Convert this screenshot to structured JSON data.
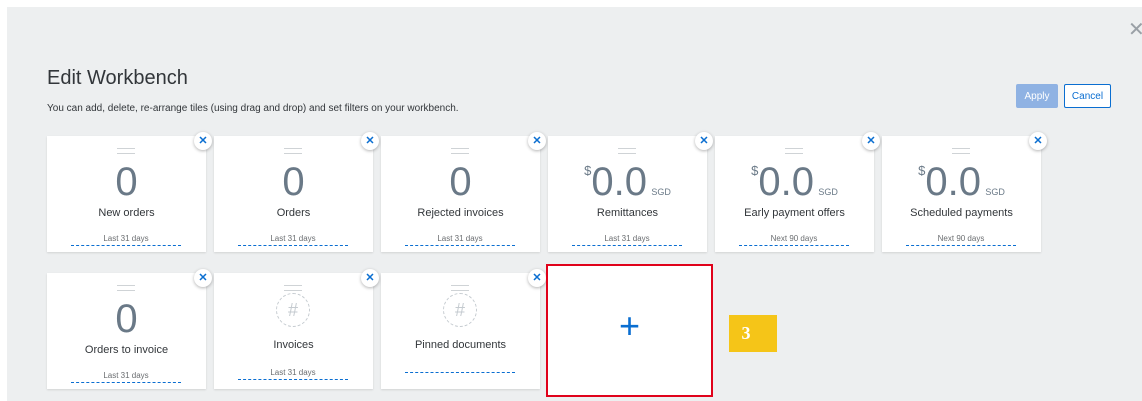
{
  "dialog": {
    "close_glyph": "✕",
    "title": "Edit Workbench",
    "subtitle": "You can add, delete, re-arrange tiles (using drag and drop) and set filters on your workbench.",
    "apply_label": "Apply",
    "cancel_label": "Cancel"
  },
  "tile_remove_glyph": "✕",
  "tiles": [
    {
      "value": "0",
      "label": "New orders",
      "period": "Last 31 days"
    },
    {
      "value": "0",
      "label": "Orders",
      "period": "Last 31 days"
    },
    {
      "value": "0",
      "label": "Rejected invoices",
      "period": "Last 31 days"
    },
    {
      "currency": "$",
      "value": "0.0",
      "unit": "SGD",
      "label": "Remittances",
      "period": "Last 31 days"
    },
    {
      "currency": "$",
      "value": "0.0",
      "unit": "SGD",
      "label": "Early payment offers",
      "period": "Next 90 days"
    },
    {
      "currency": "$",
      "value": "0.0",
      "unit": "SGD",
      "label": "Scheduled payments",
      "period": "Next 90 days"
    },
    {
      "value": "0",
      "label": "Orders to invoice",
      "period": "Last 31 days"
    },
    {
      "icon": "hash-icon",
      "icon_glyph": "#",
      "label": "Invoices",
      "period": "Last 31 days"
    },
    {
      "icon": "hash-icon",
      "icon_glyph": "#",
      "label": "Pinned documents",
      "period": ""
    }
  ],
  "add_tile": {
    "glyph": "+"
  },
  "step_badge": {
    "text": "3"
  },
  "colors": {
    "accent": "#0a6ed1",
    "highlight_border": "#e0021b",
    "badge": "#f5c518"
  }
}
